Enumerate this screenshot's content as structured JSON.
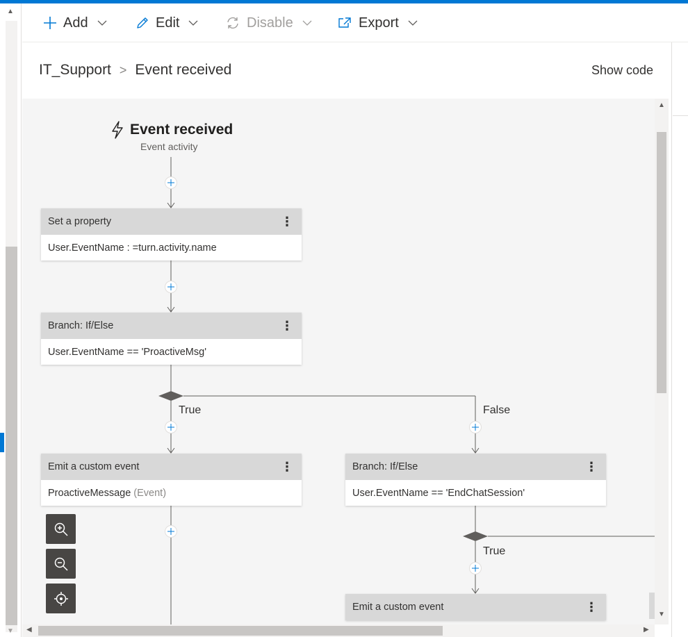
{
  "toolbar": {
    "add_label": "Add",
    "edit_label": "Edit",
    "disable_label": "Disable",
    "export_label": "Export"
  },
  "header": {
    "breadcrumb_root": "IT_Support",
    "breadcrumb_separator": ">",
    "breadcrumb_current": "Event received",
    "show_code_label": "Show code"
  },
  "trigger": {
    "title": "Event received",
    "subtitle": "Event activity",
    "icon": "lightning-icon"
  },
  "nodes": {
    "set_property": {
      "header": "Set a property",
      "body": "User.EventName : =turn.activity.name"
    },
    "branch1": {
      "header": "Branch: If/Else",
      "body": "User.EventName == 'ProactiveMsg'"
    },
    "emit1": {
      "header": "Emit a custom event",
      "body": "ProactiveMessage",
      "body_suffix": "(Event)"
    },
    "branch2": {
      "header": "Branch: If/Else",
      "body": "User.EventName == 'EndChatSession'"
    },
    "emit2": {
      "header": "Emit a custom event"
    }
  },
  "branch_labels": {
    "b1_true": "True",
    "b1_false": "False",
    "b2_true": "True"
  },
  "colors": {
    "accent": "#0078d4",
    "canvas_bg": "#f5f5f5",
    "node_header": "#d8d8d8",
    "connector": "#605e5c",
    "plus": "#0078d4",
    "zoom_button": "#484644"
  }
}
